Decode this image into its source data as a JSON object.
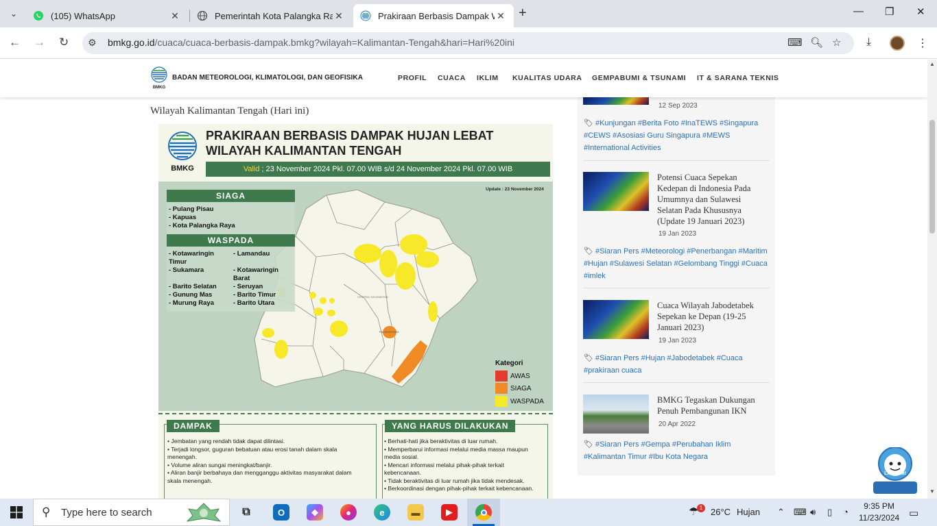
{
  "browser": {
    "tabs": [
      {
        "title": "(105) WhatsApp",
        "icon": "whatsapp-icon"
      },
      {
        "title": "Pemerintah Kota Palangka Raya",
        "icon": "globe-icon"
      },
      {
        "title": "Prakiraan Berbasis Dampak Wil",
        "icon": "bmkg-icon"
      }
    ],
    "url_host": "bmkg.go.id",
    "url_path": "/cuaca/cuaca-berbasis-dampak.bmkg?wilayah=Kalimantan-Tengah&hari=Hari%20ini"
  },
  "site": {
    "brand": "BADAN METEOROLOGI, KLIMATOLOGI, DAN GEOFISIKA",
    "logo_text": "BMKG",
    "menu": [
      "PROFIL",
      "CUACA",
      "IKLIM",
      "KUALITAS UDARA",
      "GEMPABUMI & TSUNAMI",
      "IT & SARANA TEKNIS"
    ]
  },
  "main": {
    "heading": "Wilayah Kalimantan Tengah (Hari ini)",
    "infographic": {
      "logo_text": "BMKG",
      "title_line1": "PRAKIRAAN BERBASIS DAMPAK HUJAN LEBAT",
      "title_line2": "WILAYAH KALIMANTAN TENGAH",
      "valid_label": "Valid",
      "valid_text": " ; 23 November 2024 Pkl. 07.00 WIB s/d 24 November 2024 Pkl. 07.00 WIB",
      "update": "Update : 23 November 2024",
      "siaga_title": "SIAGA",
      "siaga_list": [
        "- Pulang Pisau",
        "- Kapuas",
        "- Kota Palangka Raya"
      ],
      "waspada_title": "WASPADA",
      "waspada_col1": [
        "- Kotawaringin",
        "Timur",
        "- Sukamara",
        "",
        "- Barito Selatan",
        "- Gunung Mas",
        "- Murung Raya"
      ],
      "waspada_col2": [
        "- Lamandau",
        "",
        "- Kotawaringin",
        "Barat",
        "- Seruyan",
        "- Barito Timur",
        "- Barito Utara"
      ],
      "map_label_region": "CENTRAL KALIMANTAN",
      "map_label_city": "PALANGKA RAYA",
      "kategori_title": "Kategori",
      "kategori": [
        {
          "label": "AWAS",
          "color": "#e53b2c"
        },
        {
          "label": "SIAGA",
          "color": "#f08a24"
        },
        {
          "label": "WASPADA",
          "color": "#f7e82a"
        }
      ],
      "dampak_title": "DAMPAK",
      "dampak_lines": [
        "• Jembatan yang rendah tidak dapat dilintasi.",
        "• Terjadi longsor, guguran bebatuan atau erosi tanah dalam skala",
        "menengah.",
        "• Volume aliran sungai meningkat/banjir.",
        "• Aliran banjir berbahaya dan mengganggu aktivitas masyarakat dalam",
        "skala menengah."
      ],
      "harus_title": "YANG HARUS DILAKUKAN",
      "harus_lines": [
        "• Berhati-hati jika beraktivitas di luar rumah.",
        "• Memperbarui informasi melalui media massa maupun",
        "media sosial.",
        "• Mencari informasi melalui pihak-pihak terkait",
        "kebencanaan.",
        "• Tidak beraktivitas di luar rumah jika tidak mendesak.",
        "• Berkoordinasi dengan pihak-pihak terkait kebencanaan."
      ]
    }
  },
  "sidebar": {
    "top_date": "12 Sep 2023",
    "top_tags": "#Kunjungan #Berita Foto #InaTEWS #Singapura #CEWS #Asosiasi Guru Singapura #MEWS #International Activities",
    "items": [
      {
        "title": "Potensi Cuaca Sepekan Kedepan di Indonesia Pada Umumnya dan Sulawesi Selatan Pada Khususnya (Update 19 Januari 2023)",
        "date": "19 Jan 2023",
        "tags": "#Siaran Pers #Meteorologi #Penerbangan #Maritim #Hujan #Sulawesi Selatan #Gelombang Tinggi #Cuaca #imlek"
      },
      {
        "title": "Cuaca Wilayah Jabodetabek Sepekan ke Depan (19-25 Januari 2023)",
        "date": "19 Jan 2023",
        "tags": "#Siaran Pers #Hujan #Jabodetabek #Cuaca #prakiraan cuaca"
      },
      {
        "title": "BMKG Tegaskan Dukungan Penuh Pembangunan IKN",
        "date": "20 Apr 2022",
        "tags": "#Siaran Pers #Gempa #Perubahan Iklim #Kalimantan Timur #Ibu Kota Negara"
      }
    ],
    "livechat": "Live Chat"
  },
  "taskbar": {
    "search_placeholder": "Type here to search",
    "weather_temp": "26°C",
    "weather_text": "Hujan",
    "weather_badge": "1",
    "time": "9:35 PM",
    "date": "11/23/2024"
  },
  "colors": {
    "bmkg_green": "#3e7a4c",
    "valid_yellow": "#f5d63d",
    "link_blue": "#2a6fb5"
  }
}
